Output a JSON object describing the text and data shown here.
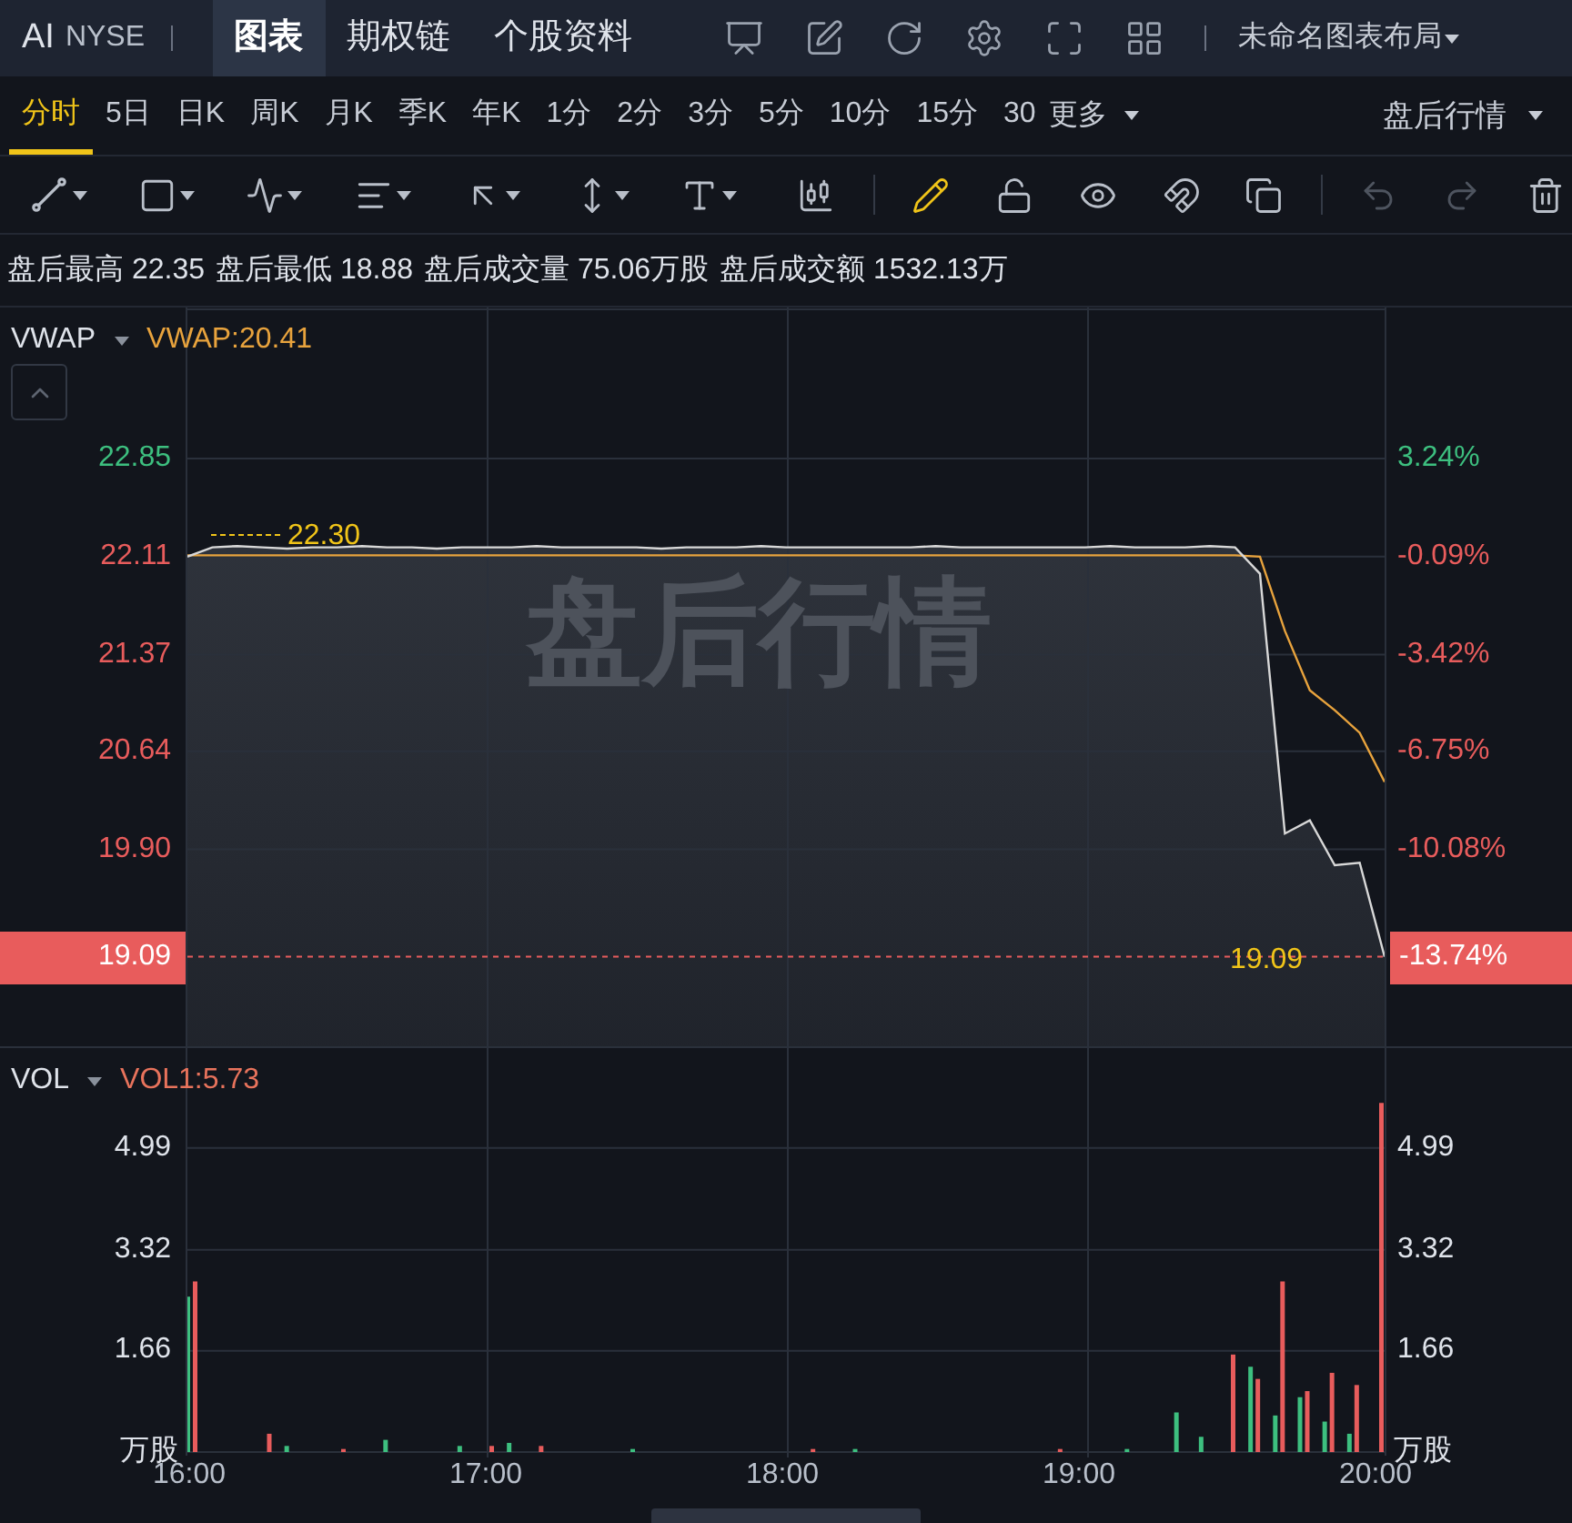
{
  "header": {
    "symbol": "AI",
    "exchange": "NYSE",
    "tabs": [
      {
        "label": "图表",
        "selected": true
      },
      {
        "label": "期权链",
        "selected": false
      },
      {
        "label": "个股资料",
        "selected": false
      }
    ],
    "layout_name": "未命名图表布局"
  },
  "periods": {
    "items": [
      {
        "label": "分时",
        "selected": true
      },
      {
        "label": "5日",
        "selected": false
      },
      {
        "label": "日K",
        "selected": false
      },
      {
        "label": "周K",
        "selected": false
      },
      {
        "label": "月K",
        "selected": false
      },
      {
        "label": "季K",
        "selected": false
      },
      {
        "label": "年K",
        "selected": false
      },
      {
        "label": "1分",
        "selected": false
      },
      {
        "label": "2分",
        "selected": false
      },
      {
        "label": "3分",
        "selected": false
      },
      {
        "label": "5分",
        "selected": false
      },
      {
        "label": "10分",
        "selected": false
      },
      {
        "label": "15分",
        "selected": false
      },
      {
        "label": "30",
        "selected": false
      }
    ],
    "more": "更多",
    "session": "盘后行情"
  },
  "tools": [
    {
      "kind": "line",
      "selected": false,
      "disabled": false
    },
    {
      "kind": "rect",
      "selected": false,
      "disabled": false
    },
    {
      "kind": "pattern",
      "selected": false,
      "disabled": false
    },
    {
      "kind": "fib",
      "selected": false,
      "disabled": false
    },
    {
      "kind": "arrow",
      "selected": false,
      "disabled": false
    },
    {
      "kind": "measure",
      "selected": false,
      "disabled": false
    },
    {
      "kind": "text",
      "selected": false,
      "disabled": false
    },
    {
      "kind": "candles",
      "selected": false,
      "disabled": false
    },
    {
      "kind": "pencil",
      "selected": true,
      "disabled": false
    },
    {
      "kind": "lock",
      "selected": false,
      "disabled": false
    },
    {
      "kind": "eye",
      "selected": false,
      "disabled": false
    },
    {
      "kind": "magnet",
      "selected": false,
      "disabled": false
    },
    {
      "kind": "layers",
      "selected": false,
      "disabled": false
    },
    {
      "kind": "undo",
      "selected": false,
      "disabled": true
    },
    {
      "kind": "redo",
      "selected": false,
      "disabled": true
    },
    {
      "kind": "trash",
      "selected": false,
      "disabled": false
    }
  ],
  "stats": [
    {
      "label": "盘后最高",
      "value": "22.35"
    },
    {
      "label": "盘后最低",
      "value": "18.88"
    },
    {
      "label": "盘后成交量",
      "value": "75.06万股"
    },
    {
      "label": "盘后成交额",
      "value": "1532.13万"
    }
  ],
  "price_panel": {
    "indicator": "VWAP",
    "indicator_value": "VWAP:20.41",
    "watermark": "盘后行情",
    "high_label": "22.30",
    "last_price": "19.09",
    "last_change": "-13.74%",
    "right_labels": [
      {
        "text": "3.24%",
        "color": "#3dbf7f"
      },
      {
        "text": "-0.09%",
        "color": "#e85c5c"
      },
      {
        "text": "-3.42%",
        "color": "#e85c5c"
      },
      {
        "text": "-6.75%",
        "color": "#e85c5c"
      },
      {
        "text": "-10.08%",
        "color": "#e85c5c"
      }
    ],
    "chart_data": {
      "type": "line",
      "grid": true,
      "ref_lines": [
        {
          "axis": "y",
          "value": 19.09,
          "label": "19.09",
          "color": "#e85c5c"
        }
      ],
      "ylim": [
        18.4,
        23.99
      ],
      "yticks": [
        {
          "value": 22.85,
          "label": "22.85"
        },
        {
          "value": 22.11,
          "label": "22.11"
        },
        {
          "value": 21.37,
          "label": "21.37"
        },
        {
          "value": 20.64,
          "label": "20.64"
        },
        {
          "value": 19.9,
          "label": "19.90"
        }
      ],
      "series": [
        {
          "color": "#d8d8d8",
          "values": [
            22.11,
            22.18,
            22.19,
            22.18,
            22.17,
            22.18,
            22.18,
            22.19,
            22.18,
            22.18,
            22.17,
            22.18,
            22.18,
            22.18,
            22.19,
            22.18,
            22.18,
            22.18,
            22.18,
            22.17,
            22.18,
            22.18,
            22.18,
            22.19,
            22.18,
            22.18,
            22.18,
            22.18,
            22.18,
            22.18,
            22.19,
            22.18,
            22.18,
            22.18,
            22.18,
            22.18,
            22.18,
            22.19,
            22.18,
            22.18,
            22.18,
            22.19,
            22.18,
            21.98,
            20.02,
            20.12,
            19.78,
            19.8,
            19.09
          ]
        },
        {
          "color": "#e8a33d",
          "values": [
            22.12,
            22.12,
            22.12,
            22.12,
            22.12,
            22.12,
            22.12,
            22.12,
            22.12,
            22.12,
            22.12,
            22.12,
            22.12,
            22.12,
            22.12,
            22.12,
            22.12,
            22.12,
            22.12,
            22.12,
            22.12,
            22.12,
            22.12,
            22.12,
            22.12,
            22.12,
            22.12,
            22.12,
            22.12,
            22.12,
            22.12,
            22.12,
            22.12,
            22.12,
            22.12,
            22.12,
            22.12,
            22.12,
            22.12,
            22.12,
            22.12,
            22.12,
            22.12,
            22.11,
            21.55,
            21.1,
            20.95,
            20.78,
            20.41
          ]
        }
      ]
    }
  },
  "volume_panel": {
    "indicator": "VOL",
    "indicator_value": "VOL1:5.73",
    "unit_left": "万股",
    "unit_right": "万股",
    "right_labels": [
      "4.99",
      "3.32",
      "1.66"
    ],
    "chart_data": {
      "type": "bar",
      "grid": true,
      "ylim": [
        0,
        6.63
      ],
      "yticks": [
        {
          "value": 4.99,
          "label": "4.99"
        },
        {
          "value": 3.32,
          "label": "3.32"
        },
        {
          "value": 1.66,
          "label": "1.66"
        }
      ],
      "categories": [
        "16:00",
        null,
        null,
        null,
        null,
        null,
        null,
        null,
        null,
        null,
        null,
        null,
        "17:00",
        null,
        null,
        null,
        null,
        null,
        null,
        null,
        null,
        null,
        null,
        null,
        "18:00",
        null,
        null,
        null,
        null,
        null,
        null,
        null,
        null,
        null,
        null,
        null,
        "19:00",
        null,
        null,
        null,
        null,
        null,
        null,
        null,
        null,
        null,
        null,
        null,
        "20:00"
      ],
      "series": [
        {
          "color": "#e85c5c",
          "values": [
            2.8,
            null,
            null,
            0.3,
            null,
            null,
            0.05,
            null,
            null,
            null,
            null,
            null,
            0.1,
            null,
            0.1,
            null,
            null,
            null,
            null,
            null,
            null,
            null,
            null,
            null,
            null,
            0.05,
            null,
            null,
            null,
            null,
            null,
            null,
            null,
            null,
            null,
            0.05,
            null,
            null,
            null,
            null,
            null,
            null,
            1.6,
            1.2,
            2.8,
            1.0,
            1.3,
            1.1,
            5.73
          ]
        },
        {
          "color": "#3dbf7f",
          "values": [
            2.55,
            null,
            null,
            null,
            0.1,
            null,
            null,
            null,
            0.2,
            null,
            null,
            0.1,
            null,
            0.15,
            null,
            null,
            null,
            null,
            0.05,
            null,
            null,
            null,
            null,
            null,
            null,
            null,
            null,
            0.05,
            null,
            null,
            null,
            null,
            null,
            null,
            null,
            null,
            null,
            null,
            0.05,
            null,
            0.65,
            0.25,
            null,
            1.4,
            0.6,
            0.9,
            0.5,
            0.3,
            null
          ]
        }
      ]
    }
  }
}
